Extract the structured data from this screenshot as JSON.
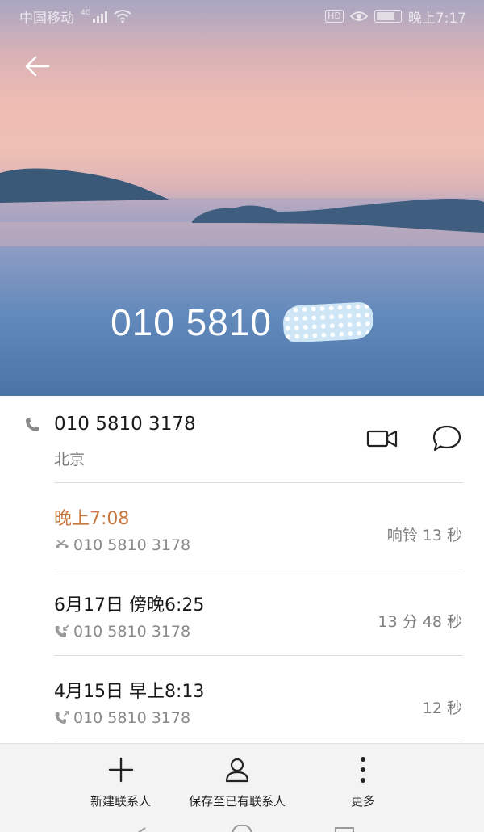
{
  "status_bar": {
    "carrier": "中国移动",
    "network": "4G",
    "hd_badge": "HD",
    "time": "晚上7:17"
  },
  "header": {
    "phone_number_visible": "010 5810",
    "back_icon": "arrow-left-icon"
  },
  "contact": {
    "number": "010 5810 3178",
    "location": "北京",
    "actions": [
      {
        "icon": "video-call-icon"
      },
      {
        "icon": "message-icon"
      }
    ]
  },
  "calls": [
    {
      "time": "晚上7:08",
      "type": "missed",
      "type_icon": "missed-call-icon",
      "number": "010 5810 3178",
      "duration": "响铃 13 秒",
      "color": "#c8773f"
    },
    {
      "time": "6月17日 傍晚6:25",
      "type": "incoming",
      "type_icon": "incoming-call-icon",
      "number": "010 5810 3178",
      "duration": "13 分 48 秒"
    },
    {
      "time": "4月15日 早上8:13",
      "type": "outgoing",
      "type_icon": "outgoing-call-icon",
      "number": "010 5810 3178",
      "duration": "12 秒"
    }
  ],
  "bottom_bar": {
    "new_contact": "新建联系人",
    "save_existing": "保存至已有联系人",
    "more": "更多"
  },
  "colors": {
    "missed_accent": "#c8773f",
    "bottom_bar_bg": "#f3f3f3"
  }
}
